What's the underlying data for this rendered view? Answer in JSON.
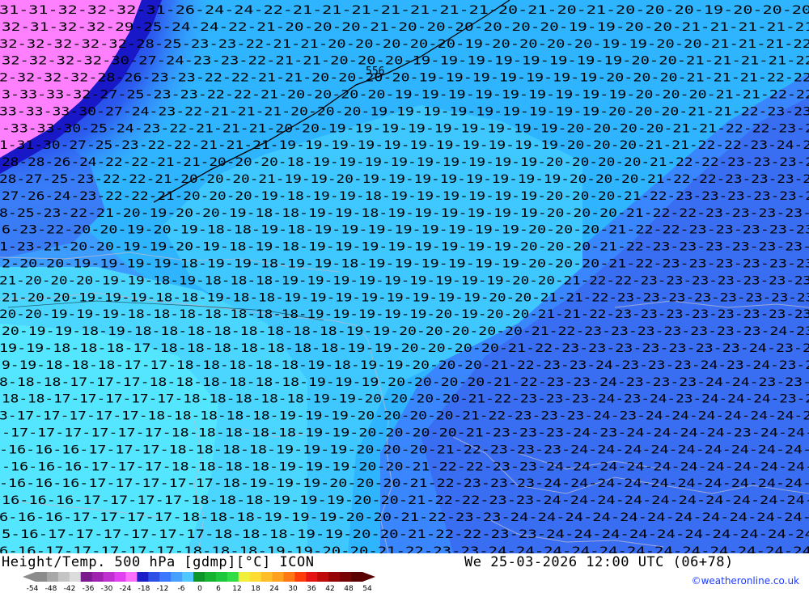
{
  "map": {
    "title": "Height/Temp. 500 hPa [gdmp][°C] ICON",
    "datetime": "We 25-03-2026 12:00 UTC (06+78)",
    "credit": "©weatheronline.co.uk",
    "contour_label": "556",
    "legend": {
      "ticks": [
        "-54",
        "-48",
        "-42",
        "-36",
        "-30",
        "-24",
        "-18",
        "-12",
        "-6",
        "0",
        "6",
        "12",
        "18",
        "24",
        "30",
        "36",
        "42",
        "48",
        "54"
      ],
      "colors": [
        "#8c8c8c",
        "#a8a8a8",
        "#c4c4c4",
        "#dcdcdc",
        "#7a1a8c",
        "#a020b0",
        "#c030d0",
        "#e040f0",
        "#ff70ff",
        "#1e1ec8",
        "#2d50e6",
        "#3c78ff",
        "#46a0ff",
        "#50c8ff",
        "#0a9628",
        "#14b432",
        "#1ec83c",
        "#32dc46",
        "#f0f03c",
        "#ffdc32",
        "#ffbe28",
        "#ffa01e",
        "#ff7814",
        "#ff3c0a",
        "#e61414",
        "#be0a0a",
        "#960505",
        "#780303",
        "#5a0202"
      ]
    },
    "temperature_colors": {
      "-33": "#ff80ff",
      "-27": "#2040e0",
      "-24": "#3070f0",
      "-22": "#3c8cff",
      "-19": "#40c8ff",
      "-17": "#50e4ff"
    },
    "label_rows": [
      "31-31-32-32-32-31-26-24-24-22-21-21-21-21-21-21-21-20-21-20-21-20-20-20-19-20-20-20",
      "32-31-32-32-29-25-24-24-22-21-20-20-20-21-20-20-20-20-20-20-19-19-20-20-21-21-21-21-21",
      "32-32-32-32-32-28-25-23-23-22-21-21-20-20-20-20-20-19-20-20-20-20-19-19-20-20-21-21-21-22",
      "32-32-32-32-30-27-24-23-23-22-21-21-20-20-20-19-19-19-19-19-19-19-19-20-20-21-21-21-21-22",
      "2-32-32-32-28-26-23-23-22-22-21-21-20-20-20-20-19-19-19-19-19-19-19-20-20-20-21-21-21-22-22",
      "3-33-33-32-27-25-23-23-22-22-21-20-20-20-20-19-19-19-19-19-19-19-19-19-20-20-20-21-21-22-22",
      "33-33-33-30-27-24-23-22-21-21-21-20-20-20-19-19-19-19-19-19-19-19-19-20-20-20-21-21-22-23-23",
      "-33-33-30-25-24-23-22-21-21-21-20-20-19-19-19-19-19-19-19-19-19-20-20-20-20-21-21-22-22-23-2",
      "1-31-30-27-25-23-22-22-21-21-21-19-19-19-19-19-19-19-19-19-19-19-20-20-20-21-21-22-22-23-24-2",
      "28-28-26-24-22-22-21-21-20-20-20-18-19-19-19-19-19-19-19-19-19-20-20-20-20-21-22-22-23-23-23-2",
      "28-27-25-23-22-22-21-20-20-20-21-19-19-20-19-19-19-19-19-19-19-19-20-20-20-21-22-22-23-23-23-2",
      "27-26-24-23-22-22-21-20-20-20-19-18-19-19-18-19-19-19-19-19-19-20-20-20-21-22-23-23-23-23-23-2",
      "8-25-23-22-21-20-19-20-20-19-18-18-19-19-18-19-19-19-19-19-19-20-20-20-21-22-22-23-23-23-23-",
      "6-23-22-20-20-19-20-19-18-18-19-18-19-19-19-19-19-19-19-19-20-20-20-21-22-22-23-23-23-23-23",
      "1-23-21-20-20-19-19-20-19-18-19-18-19-19-19-19-19-19-19-19-20-20-20-21-22-23-23-23-23-23-23-",
      "2-20-20-19-19-19-19-18-19-19-18-19-19-18-19-19-19-19-19-19-20-20-20-21-22-23-23-23-23-23-23",
      "21-20-20-20-19-19-18-19-18-18-18-19-19-19-19-19-19-19-19-19-20-20-21-22-22-23-23-23-23-23-23-23",
      "21-20-20-19-19-19-18-18-19-18-18-19-19-19-19-19-19-19-19-20-20-21-21-22-23-23-23-23-23-23-23-23",
      "20-20-19-19-19-18-18-18-18-18-18-18-19-19-19-19-19-20-19-20-20-21-21-22-23-23-23-23-23-23-23-23",
      "20-19-19-18-19-18-18-18-18-18-18-18-18-19-19-20-20-20-20-20-21-22-23-23-23-23-23-23-23-24-23",
      "19-19-18-18-18-17-18-18-18-18-18-18-18-19-19-20-20-20-20-21-22-23-23-23-23-23-23-23-24-23-2",
      "9-19-18-18-18-17-17-18-18-18-18-18-19-18-19-19-20-20-20-21-22-23-23-24-23-23-23-24-23-24-23-2",
      "8-18-18-17-17-17-18-18-18-18-18-18-19-19-19-20-20-20-20-21-22-23-23-24-23-23-23-24-24-23-23-",
      "18-18-17-17-17-17-17-18-18-18-18-18-19-19-20-20-20-20-21-22-23-23-23-24-23-24-23-24-24-24-23-2",
      "3-17-17-17-17-17-18-18-18-18-18-19-19-19-20-20-20-20-21-22-23-23-23-24-23-24-24-24-24-24-24-2",
      "-17-17-17-17-17-17-18-18-18-18-18-19-19-20-20-20-20-21-23-23-23-24-23-24-24-24-24-23-24-24-",
      "-16-16-16-17-17-17-18-18-18-18-19-19-19-20-20-20-21-22-23-23-23-24-24-24-24-24-24-24-24-24-",
      "-16-16-16-17-17-17-18-18-18-18-19-19-19-20-20-21-22-22-23-23-24-24-24-24-24-24-24-24-24-24-",
      "-16-16-16-17-17-17-17-17-18-19-19-19-20-20-20-21-22-23-23-23-24-24-24-24-24-24-24-24-24-24-",
      "16-16-16-17-17-17-17-18-18-18-19-19-19-20-20-21-22-22-23-23-24-24-24-24-24-24-24-24-24-24-",
      "6-16-16-17-17-17-17-18-18-18-19-19-19-20-20-21-22-23-23-24-24-24-24-24-24-24-24-24-24-24-",
      "5-16-17-17-17-17-17-17-18-18-18-19-19-20-20-21-22-22-23-23-24-24-24-24-24-24-24-24-24-24",
      "6-16-17-17-17-17-17-18-18-18-19-19-20-20-21-22-23-23-24-24-24-24-24-24-24-24-24-24-24-24",
      "5-17-17-17-17-17-17-18-18-18-19-20-20-21-22-22-23-23-24-24-24-24-24-24-24-24-24-24-24-24"
    ]
  }
}
